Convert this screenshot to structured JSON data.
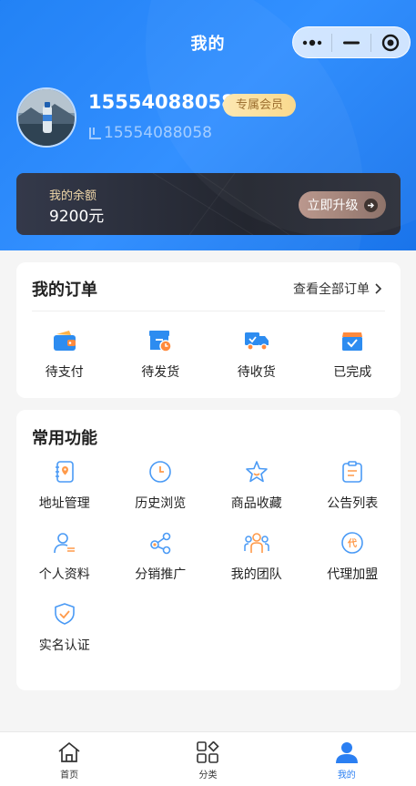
{
  "header": {
    "title": "我的",
    "colors": {
      "brand": "#1a7df5",
      "accent": "#2b7ff2",
      "vip_bg": "#fde8b0"
    }
  },
  "capsule": {
    "menu_icon": "more-dots-icon",
    "minimize_icon": "minimize-icon",
    "close_icon": "target-icon"
  },
  "profile": {
    "phone": "15554088058",
    "badge": "专属会员",
    "sub_phone": "15554088058"
  },
  "balance": {
    "label": "我的余额",
    "value": "9200元",
    "upgrade_label": "立即升级"
  },
  "orders": {
    "title": "我的订单",
    "see_all": "查看全部订单",
    "items": [
      {
        "label": "待支付",
        "icon": "wallet-icon"
      },
      {
        "label": "待发货",
        "icon": "box-clock-icon"
      },
      {
        "label": "待收货",
        "icon": "truck-icon"
      },
      {
        "label": "已完成",
        "icon": "box-check-icon"
      }
    ]
  },
  "functions": {
    "title": "常用功能",
    "items": [
      {
        "label": "地址管理",
        "icon": "address-icon"
      },
      {
        "label": "历史浏览",
        "icon": "clock-icon"
      },
      {
        "label": "商品收藏",
        "icon": "star-icon"
      },
      {
        "label": "公告列表",
        "icon": "clipboard-icon"
      },
      {
        "label": "个人资料",
        "icon": "user-profile-icon"
      },
      {
        "label": "分销推广",
        "icon": "share-icon"
      },
      {
        "label": "我的团队",
        "icon": "team-icon"
      },
      {
        "label": "代理加盟",
        "icon": "agent-icon"
      },
      {
        "label": "实名认证",
        "icon": "shield-check-icon"
      }
    ]
  },
  "tabbar": {
    "items": [
      {
        "label": "首页",
        "icon": "home-icon"
      },
      {
        "label": "分类",
        "icon": "category-icon"
      },
      {
        "label": "我的",
        "icon": "user-icon",
        "active": true
      }
    ]
  }
}
